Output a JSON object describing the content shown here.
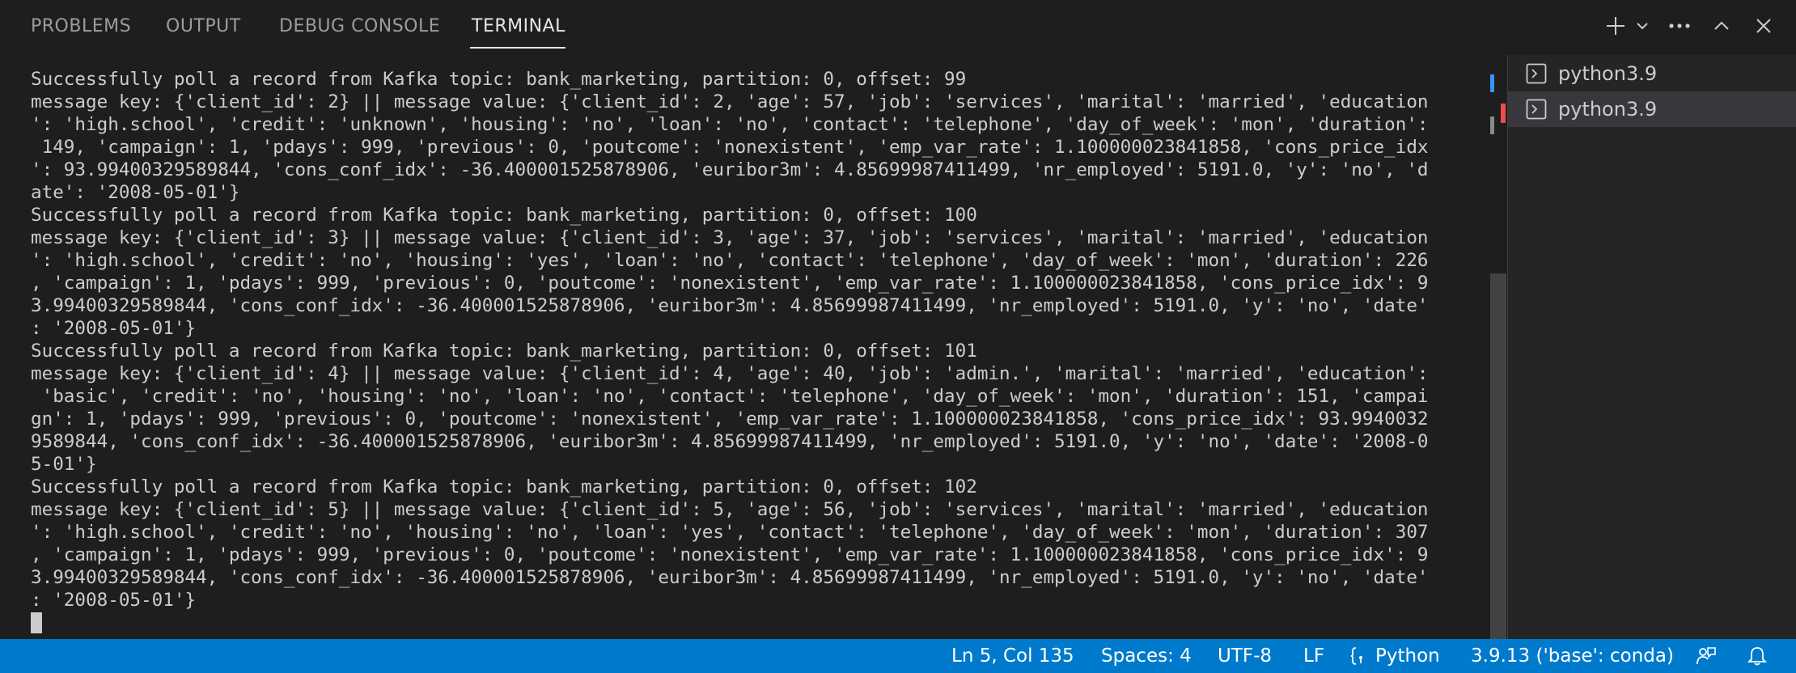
{
  "tabs": [
    {
      "label": "PROBLEMS"
    },
    {
      "label": "OUTPUT"
    },
    {
      "label": "DEBUG CONSOLE"
    },
    {
      "label": "TERMINAL"
    }
  ],
  "active_tab": "TERMINAL",
  "actions": [
    "plus-icon",
    "chevron-down-icon",
    "ellipsis-icon",
    "chevron-up-icon",
    "close-icon"
  ],
  "terminal": {
    "lines": [
      "Successfully poll a record from Kafka topic: bank_marketing, partition: 0, offset: 99",
      "message key: {'client_id': 2} || message value: {'client_id': 2, 'age': 57, 'job': 'services', 'marital': 'married', 'education",
      "': 'high.school', 'credit': 'unknown', 'housing': 'no', 'loan': 'no', 'contact': 'telephone', 'day_of_week': 'mon', 'duration':",
      " 149, 'campaign': 1, 'pdays': 999, 'previous': 0, 'poutcome': 'nonexistent', 'emp_var_rate': 1.100000023841858, 'cons_price_idx",
      "': 93.99400329589844, 'cons_conf_idx': -36.400001525878906, 'euribor3m': 4.85699987411499, 'nr_employed': 5191.0, 'y': 'no', 'd",
      "ate': '2008-05-01'}",
      "Successfully poll a record from Kafka topic: bank_marketing, partition: 0, offset: 100",
      "message key: {'client_id': 3} || message value: {'client_id': 3, 'age': 37, 'job': 'services', 'marital': 'married', 'education",
      "': 'high.school', 'credit': 'no', 'housing': 'yes', 'loan': 'no', 'contact': 'telephone', 'day_of_week': 'mon', 'duration': 226",
      ", 'campaign': 1, 'pdays': 999, 'previous': 0, 'poutcome': 'nonexistent', 'emp_var_rate': 1.100000023841858, 'cons_price_idx': 9",
      "3.99400329589844, 'cons_conf_idx': -36.400001525878906, 'euribor3m': 4.85699987411499, 'nr_employed': 5191.0, 'y': 'no', 'date'",
      ": '2008-05-01'}",
      "Successfully poll a record from Kafka topic: bank_marketing, partition: 0, offset: 101",
      "message key: {'client_id': 4} || message value: {'client_id': 4, 'age': 40, 'job': 'admin.', 'marital': 'married', 'education':",
      " 'basic', 'credit': 'no', 'housing': 'no', 'loan': 'no', 'contact': 'telephone', 'day_of_week': 'mon', 'duration': 151, 'campai",
      "gn': 1, 'pdays': 999, 'previous': 0, 'poutcome': 'nonexistent', 'emp_var_rate': 1.100000023841858, 'cons_price_idx': 93.9940032",
      "9589844, 'cons_conf_idx': -36.400001525878906, 'euribor3m': 4.85699987411499, 'nr_employed': 5191.0, 'y': 'no', 'date': '2008-0",
      "5-01'}",
      "Successfully poll a record from Kafka topic: bank_marketing, partition: 0, offset: 102",
      "message key: {'client_id': 5} || message value: {'client_id': 5, 'age': 56, 'job': 'services', 'marital': 'married', 'education",
      "': 'high.school', 'credit': 'no', 'housing': 'no', 'loan': 'yes', 'contact': 'telephone', 'day_of_week': 'mon', 'duration': 307",
      ", 'campaign': 1, 'pdays': 999, 'previous': 0, 'poutcome': 'nonexistent', 'emp_var_rate': 1.100000023841858, 'cons_price_idx': 9",
      "3.99400329589844, 'cons_conf_idx': -36.400001525878906, 'euribor3m': 4.85699987411499, 'nr_employed': 5191.0, 'y': 'no', 'date'",
      ": '2008-05-01'}"
    ]
  },
  "terminal_list": [
    {
      "label": "python3.9",
      "icon": "terminal-icon",
      "selected": false
    },
    {
      "label": "python3.9",
      "icon": "terminal-icon",
      "selected": true
    }
  ],
  "status_bar": {
    "cursor_position": "Ln 5, Col 135",
    "indentation": "Spaces: 4",
    "encoding": "UTF-8",
    "line_ending": "LF",
    "language": "Python",
    "interpreter": "3.9.13 ('base': conda)",
    "background_color": "#007acc"
  },
  "colors": {
    "panel_background": "#1e1e1e",
    "sidebar_background": "#252526",
    "selected_item": "#37373d",
    "text": "#cccccc",
    "scroll_marker_blue": "#3794ff",
    "scroll_marker_red": "#f14c4c"
  }
}
